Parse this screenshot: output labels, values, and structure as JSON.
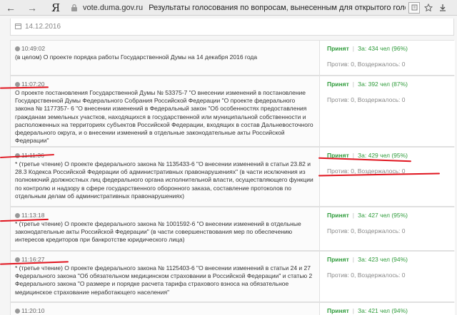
{
  "browser": {
    "back_glyph": "←",
    "forward_glyph": "→",
    "logo": "Я",
    "url": "vote.duma.gov.ru",
    "title": "Результаты голосования по вопросам, вынесенным для открытого голосования за пе...",
    "icons": [
      "back-arrow-icon",
      "forward-arrow-icon",
      "yandex-logo",
      "lock-icon",
      "page-action-icon",
      "bookmark-star-icon",
      "download-icon"
    ]
  },
  "date": "14.12.2016",
  "votes": [
    {
      "time": "10:49:02",
      "text": "(в целом) О проекте порядка работы Государственной Думы на 14 декабря 2016 года",
      "status": "Принят",
      "za": "За: 434 чел (96%)",
      "against": "Против: 0, Воздержалось: 0"
    },
    {
      "time": "11:07:20",
      "text": "О проекте постановления Государственной Думы № 53375-7 \"О внесении изменений в постановление Государственной Думы Федерального Собрания Российской Федерации \"О проекте федерального закона № 1177357- 6 \"О внесении изменений в Федеральный закон \"Об особенностях предоставления гражданам земельных участков, находящихся в государственной или муниципальной собственности и расположенных на территориях субъектов Российской Федерации, входящих в состав Дальневосточного федерального округа, и о внесении изменений в отдельные законодательные акты Российской Федерации\"",
      "status": "Принят",
      "za": "За: 392 чел (87%)",
      "against": "Против: 0, Воздержалось: 0"
    },
    {
      "time": "11:11:36",
      "text": "* (третье чтение) О проекте федерального закона № 1135433-6 \"О внесении изменений в статьи 23.82 и 28.3 Кодекса Российской Федерации об административных правонарушениях\" (в части исключения из полномочий должностных лиц федерального органа исполнительной власти, осуществляющего функции по контролю и надзору в сфере государственного оборонного заказа, составление протоколов по отдельным делам об административных правонарушениях)",
      "status": "Принят",
      "za": "За: 429 чел (95%)",
      "against": "Против: 0, Воздержалось: 0"
    },
    {
      "time": "11:13:18",
      "text": "* (третье чтение) О проекте федерального закона № 1001592-6 \"О внесении изменений в отдельные законодательные акты Российской Федерации\" (в части совершенствования мер по обеспечению интересов кредиторов при банкротстве юридического лица)",
      "status": "Принят",
      "za": "За: 427 чел (95%)",
      "against": "Против: 0, Воздержалось: 0"
    },
    {
      "time": "11:16:27",
      "text": "* (третье чтение) О проекте федерального закона № 1125403-6 \"О внесении изменений в статьи 24 и 27 Федерального закона \"Об обязательном медицинском страховании в Российской Федерации\" и статью 2 Федерального закона \"О размере и порядке расчета тарифа страхового взноса на обязательное медицинское страхование неработающего населения\"",
      "status": "Принят",
      "za": "За: 423 чел (94%)",
      "against": "Против: 0, Воздержалось: 0"
    },
    {
      "time": "11:20:10",
      "text": "",
      "status": "Принят",
      "za": "За: 421 чел (94%)",
      "against": ""
    }
  ],
  "colors": {
    "accepted": "#2e9b3a",
    "annotation": "#e0141e"
  }
}
